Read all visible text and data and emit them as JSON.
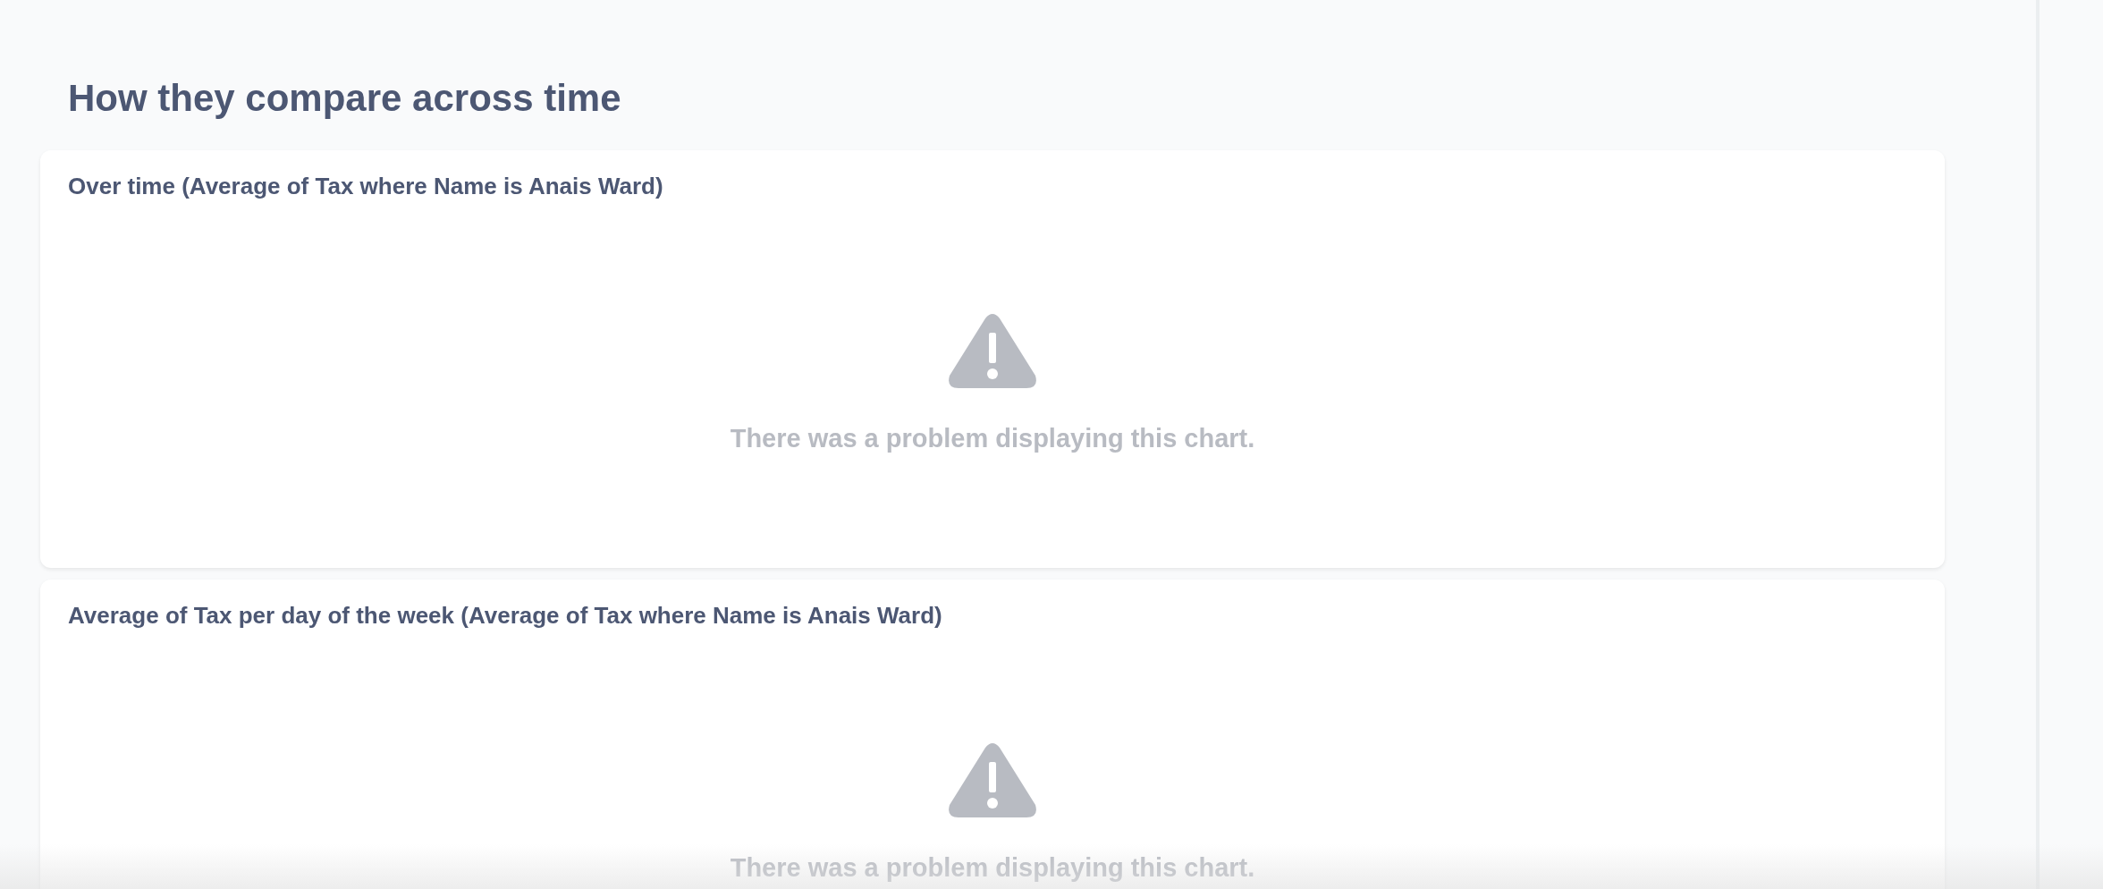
{
  "section_title": "How they compare across time",
  "cards": [
    {
      "title": "Over time (Average of Tax where Name is Anais Ward)",
      "kind": "error",
      "message": "There was a problem displaying this chart."
    },
    {
      "title": "Average of Tax per day of the week (Average of Tax where Name is Anais Ward)",
      "kind": "error",
      "message": "There was a problem displaying this chart."
    }
  ]
}
